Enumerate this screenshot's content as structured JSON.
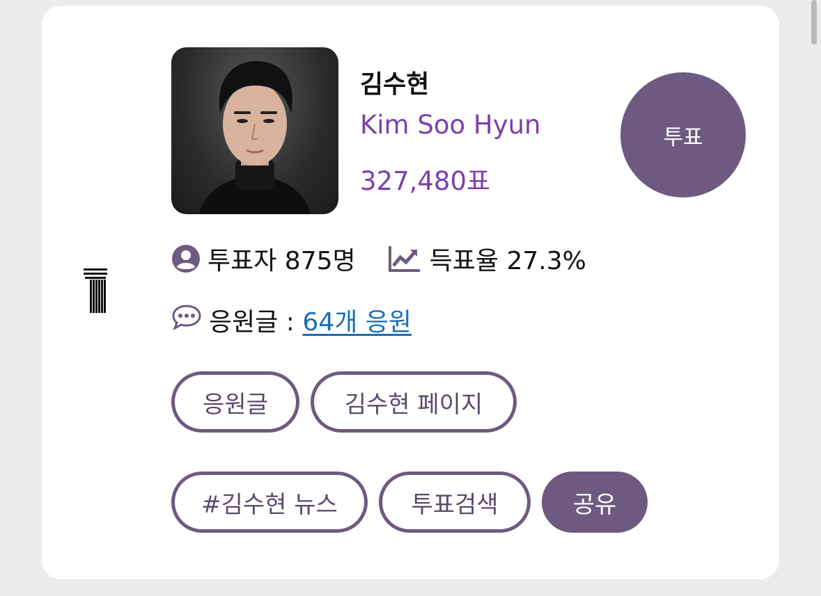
{
  "profile": {
    "name_ko": "김수현",
    "name_en": "Kim Soo Hyun",
    "votes": "327,480표",
    "vote_button": "투표"
  },
  "stats": {
    "voters": "투표자 875명",
    "rate": "득표율 27.3%"
  },
  "comments": {
    "label": "응원글 : ",
    "link": "64개 응원"
  },
  "buttons": {
    "cheer": "응원글",
    "page": "김수현 페이지",
    "news": "#김수현 뉴스",
    "search": "투표검색",
    "share": "공유"
  },
  "colors": {
    "accent": "#6e5a80",
    "name_en": "#7b3fae",
    "link": "#1a6db4",
    "card": "#ffffff",
    "background": "#ececec"
  },
  "icons": [
    "rank-icon",
    "user-circle-icon",
    "trend-chart-icon",
    "chat-bubble-icon"
  ]
}
